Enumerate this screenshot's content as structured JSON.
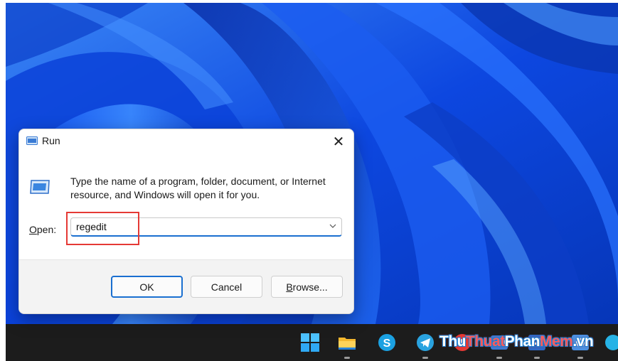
{
  "dialog": {
    "title": "Run",
    "close_glyph": "✕",
    "message": "Type the name of a program, folder, document, or Internet resource, and Windows will open it for you.",
    "open_label_mnemonic": "O",
    "open_label_rest": "pen:",
    "input_value": "regedit",
    "buttons": {
      "ok": "OK",
      "cancel": "Cancel",
      "browse_mnemonic": "B",
      "browse_rest": "rowse..."
    },
    "accent_color": "#1a6fd0",
    "highlight_color": "#e53935"
  },
  "taskbar": {
    "icons": [
      "windows-start-icon",
      "file-explorer-icon",
      "skype-icon",
      "telegram-icon",
      "app-icon",
      "app-icon",
      "app-icon",
      "app-icon"
    ]
  },
  "watermark": {
    "part1": "Thu",
    "part2": "Thuat",
    "part3": "Phan",
    "part4": "Mem",
    "part5": ".vn"
  }
}
